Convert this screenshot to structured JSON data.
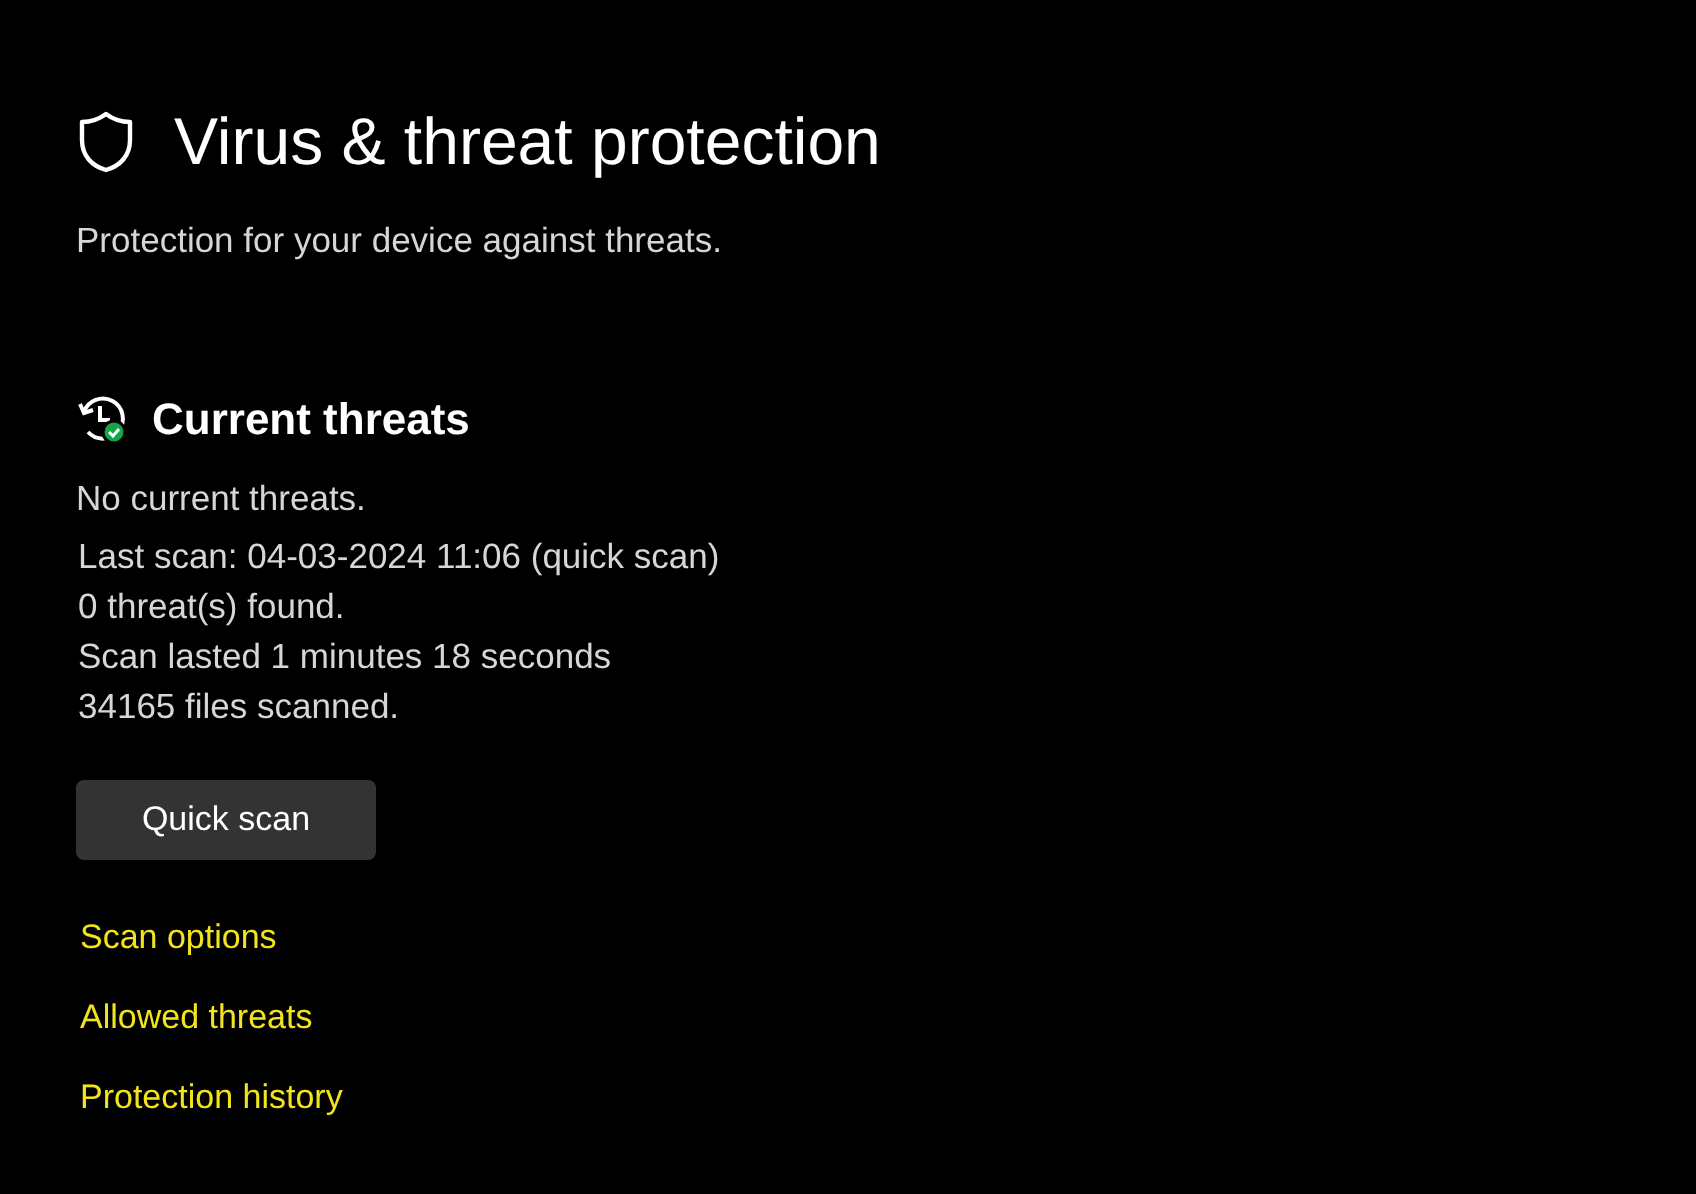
{
  "page": {
    "title": "Virus & threat protection",
    "subtitle": "Protection for your device against threats."
  },
  "section": {
    "title": "Current threats",
    "status": "No current threats.",
    "details": [
      "Last scan: 04-03-2024 11:06 (quick scan)",
      "0 threat(s) found.",
      "Scan lasted 1 minutes 18 seconds",
      "34165 files scanned."
    ],
    "button": "Quick scan",
    "links": [
      "Scan options",
      "Allowed threats",
      "Protection history"
    ]
  }
}
